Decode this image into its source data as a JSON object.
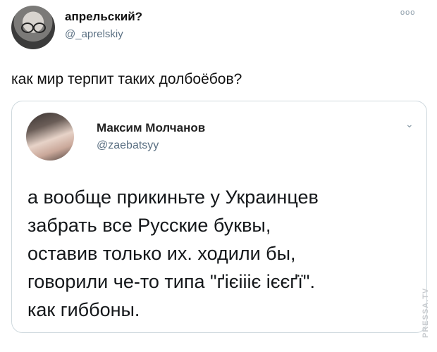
{
  "tweet": {
    "author": {
      "name": "апрельский?",
      "handle": "@_aprelskiy"
    },
    "more_label": "ooo",
    "text": "как мир терпит таких долбоёбов?",
    "quoted": {
      "name": "Максим Молчанов",
      "handle": "@zaebatsyy",
      "chevron": "⌄",
      "lines": [
        "а вообще прикиньте у Украинцев",
        "забрать все Русские буквы,",
        "оставив только их. ходили бы,",
        "говорили че-то типа \"ґієіііє ієєґї\".",
        "как гиббоны."
      ]
    }
  },
  "watermark": "PRESSA.TV"
}
